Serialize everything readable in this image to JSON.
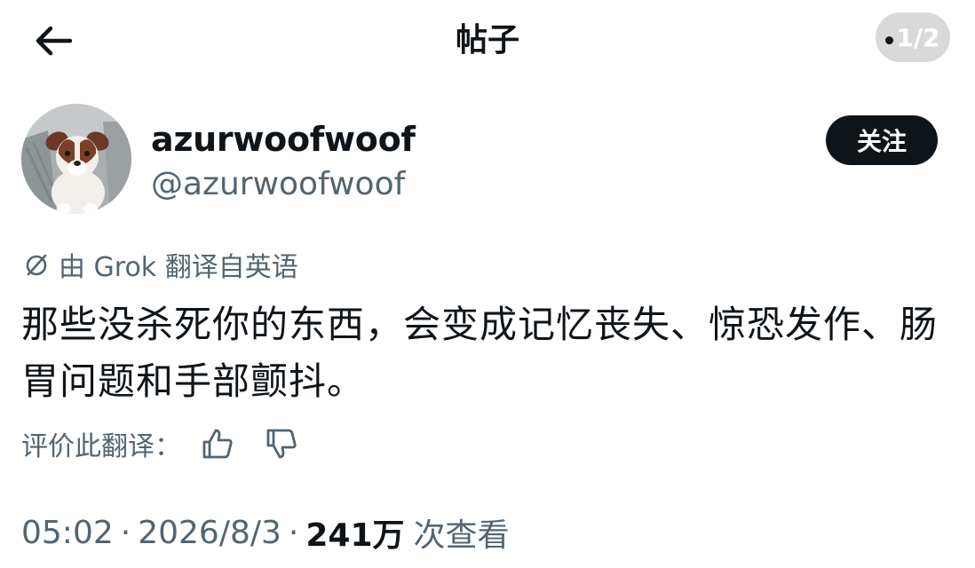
{
  "header": {
    "title": "帖子",
    "page_indicator": "1/2"
  },
  "author": {
    "display_name": "azurwoofwoof",
    "handle": "@azurwoofwoof",
    "follow_label": "关注"
  },
  "translation": {
    "note": "由 Grok 翻译自英语",
    "rate_label": "评价此翻译："
  },
  "post": {
    "text": "那些没杀死你的东西，会变成记忆丧失、惊恐发作、肠胃问题和手部颤抖。"
  },
  "meta": {
    "time": "05:02",
    "date": "2026/8/3",
    "views_count": "241万",
    "views_label": "次查看",
    "separator": "·"
  },
  "icons": {
    "back": "arrow-left-icon",
    "translate": "slashed-circle-icon",
    "thumbs_up": "thumbs-up-icon",
    "thumbs_down": "thumbs-down-icon"
  },
  "colors": {
    "text_primary": "#0f1419",
    "text_secondary": "#536471",
    "follow_bg": "#0f1419",
    "indicator_bg": "#d9d9d9"
  }
}
